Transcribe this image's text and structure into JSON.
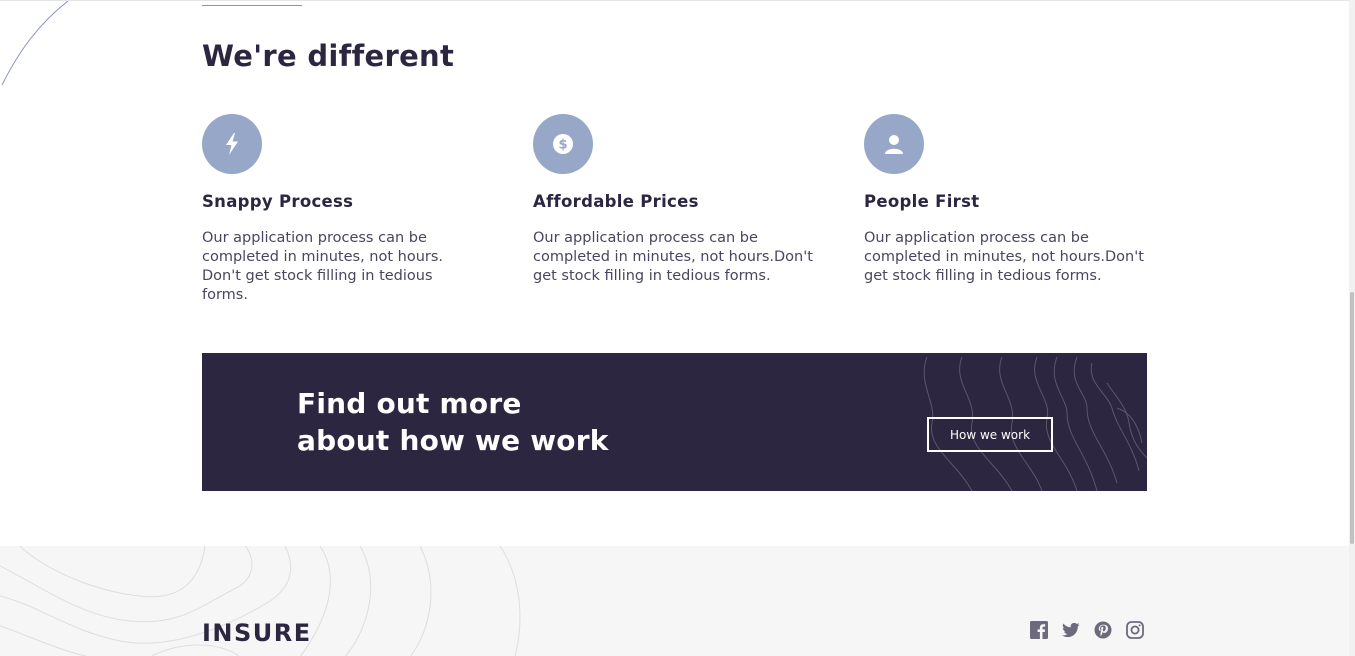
{
  "section": {
    "title": "We're different"
  },
  "features": [
    {
      "icon": "lightning-icon",
      "title": "Snappy Process",
      "text": "Our application process can be completed in minutes, not hours. Don't get stock filling in tedious forms."
    },
    {
      "icon": "dollar-icon",
      "title": "Affordable Prices",
      "text": "Our application process can be completed in minutes, not hours.Don't get stock filling in tedious forms."
    },
    {
      "icon": "person-icon",
      "title": "People First",
      "text": "Our application process can be completed in minutes, not hours.Don't get stock filling in tedious forms."
    }
  ],
  "cta": {
    "title_line1": "Find out more",
    "title_line2": "about how we work",
    "button_label": "How we work"
  },
  "footer": {
    "logo": "INSURE",
    "social": [
      "facebook-icon",
      "twitter-icon",
      "pinterest-icon",
      "instagram-icon"
    ]
  },
  "colors": {
    "dark_violet": "#2c2640",
    "icon_circle": "#97a7c7",
    "footer_bg": "#f6f6f6",
    "body_text": "#4a4560"
  }
}
